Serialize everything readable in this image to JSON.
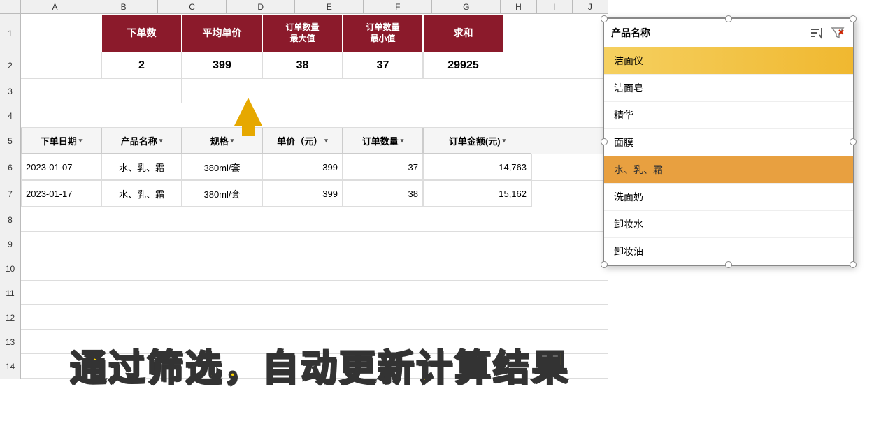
{
  "columns": {
    "row_num_width": 30,
    "A": 120,
    "B": 120,
    "C": 120,
    "D": 120,
    "E": 120,
    "F": 120,
    "G": 120,
    "H": 120,
    "I": 120,
    "J": 120
  },
  "col_labels": [
    "A",
    "B",
    "C",
    "D",
    "E",
    "F",
    "G",
    "H",
    "I",
    "J"
  ],
  "summary_table": {
    "headers": [
      "下单数",
      "平均单价",
      "订单数量\n最大值",
      "订单数量\n最小值",
      "求和"
    ],
    "headers_display": [
      "下单数",
      "平均单价",
      "订单数量最大值",
      "订单数量最小值",
      "求和"
    ],
    "data": [
      "2",
      "399",
      "38",
      "37",
      "29925"
    ]
  },
  "data_table": {
    "headers": [
      "下单日期",
      "产品名称",
      "规格",
      "单价（元）",
      "订单数量",
      "订单金额(元)"
    ],
    "rows": [
      [
        "2023-01-07",
        "水、乳、霜",
        "380ml/套",
        "399",
        "37",
        "14,763"
      ],
      [
        "2023-01-17",
        "水、乳、霜",
        "380ml/套",
        "399",
        "38",
        "15,162"
      ]
    ]
  },
  "row_numbers": {
    "empty_rows": [
      "3",
      "4",
      "5",
      "6",
      "7",
      "8"
    ],
    "data_rows_before_table": [
      "1",
      "2",
      "3"
    ],
    "all_rows": [
      "1",
      "2",
      "3",
      "4",
      "5",
      "6",
      "7",
      "8",
      "9",
      "10",
      "11",
      "12",
      "13"
    ]
  },
  "arrow": {
    "direction": "up",
    "color": "#e6a800"
  },
  "filter_panel": {
    "title": "产品名称",
    "items": [
      {
        "label": "洁面仪",
        "state": "selected-yellow"
      },
      {
        "label": "洁面皂",
        "state": "normal"
      },
      {
        "label": "精华",
        "state": "normal"
      },
      {
        "label": "面膜",
        "state": "normal"
      },
      {
        "label": "水、乳、霜",
        "state": "selected-orange"
      },
      {
        "label": "洗面奶",
        "state": "normal"
      },
      {
        "label": "卸妆水",
        "state": "normal"
      },
      {
        "label": "卸妆油",
        "state": "normal"
      }
    ],
    "icons": {
      "sort": "≡↕",
      "filter": "▽✕"
    }
  },
  "annotation": {
    "text": "通过筛选，自动更新计算结果"
  },
  "colors": {
    "summary_header_bg": "#8b1a2b",
    "summary_header_text": "#ffffff",
    "col_header_bg": "#f0f0f0",
    "row_num_bg": "#f0f0f0",
    "filter_selected_yellow": "#f5d060",
    "filter_selected_orange": "#e8a040",
    "annotation_fill": "#ffd700",
    "annotation_stroke": "#333333",
    "arrow_color": "#e6a800"
  }
}
